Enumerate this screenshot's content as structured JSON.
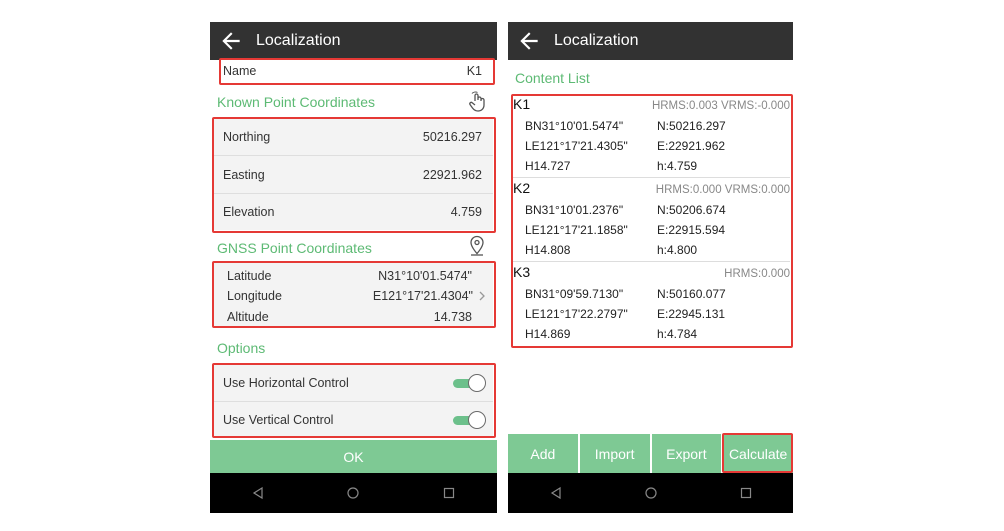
{
  "left": {
    "title": "Localization",
    "name_label": "Name",
    "name_value": "K1",
    "known_section": "Known Point Coordinates",
    "known": [
      {
        "label": "Northing",
        "value": "50216.297"
      },
      {
        "label": "Easting",
        "value": "22921.962"
      },
      {
        "label": "Elevation",
        "value": "4.759"
      }
    ],
    "gnss_section": "GNSS Point Coordinates",
    "gnss": [
      {
        "label": "Latitude",
        "value": "N31°10'01.5474\""
      },
      {
        "label": "Longitude",
        "value": "E121°17'21.4304\""
      },
      {
        "label": "Altitude",
        "value": "14.738"
      }
    ],
    "options_section": "Options",
    "options": [
      {
        "label": "Use Horizontal Control",
        "on": true
      },
      {
        "label": "Use Vertical Control",
        "on": true
      }
    ],
    "ok_label": "OK"
  },
  "right": {
    "title": "Localization",
    "content_list_label": "Content List",
    "points": [
      {
        "name": "K1",
        "rms": "HRMS:0.003 VRMS:-0.000",
        "b": "BN31°10'01.5474\"",
        "l": "LE121°17'21.4305\"",
        "h": "H14.727",
        "n": "N:50216.297",
        "e": "E:22921.962",
        "hh": "h:4.759"
      },
      {
        "name": "K2",
        "rms": "HRMS:0.000 VRMS:0.000",
        "b": "BN31°10'01.2376\"",
        "l": "LE121°17'21.1858\"",
        "h": "H14.808",
        "n": "N:50206.674",
        "e": "E:22915.594",
        "hh": "h:4.800"
      },
      {
        "name": "K3",
        "rms": "HRMS:0.000",
        "b": "BN31°09'59.7130\"",
        "l": "LE121°17'22.2797\"",
        "h": "H14.869",
        "n": "N:50160.077",
        "e": "E:22945.131",
        "hh": "h:4.784"
      }
    ],
    "buttons": [
      "Add",
      "Import",
      "Export",
      "Calculate"
    ]
  }
}
